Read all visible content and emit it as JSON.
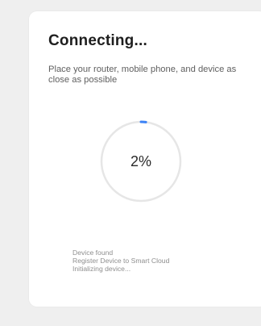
{
  "connect": {
    "title": "Connecting...",
    "subtitle": "Place your router, mobile phone, and device as close as possible",
    "progress_percent": 2,
    "progress_text": "2%",
    "steps": [
      "Device found",
      "Register Device to Smart Cloud",
      "Initializing device..."
    ]
  },
  "colors": {
    "background": "#efefef",
    "card": "#ffffff",
    "ring_track": "#e6e6e6",
    "ring_progress": "#3b82f6",
    "title": "#1e1e1e",
    "subtitle": "#5f5f5f",
    "steps": "#8f8f8f"
  }
}
